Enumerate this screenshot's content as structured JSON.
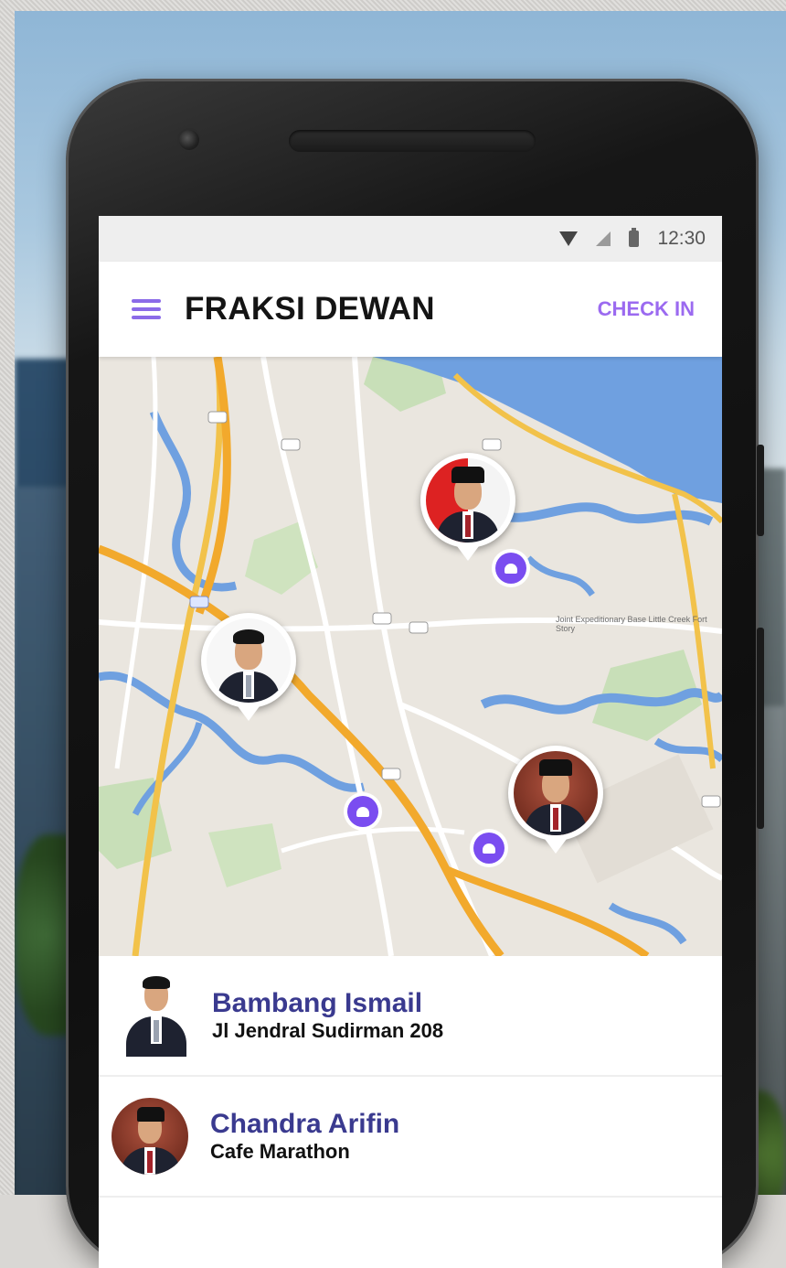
{
  "status_bar": {
    "time": "12:30"
  },
  "app_bar": {
    "title": "FRAKSI DEWAN",
    "action_label": "CHECK IN"
  },
  "map": {
    "labels": [
      "Joint Expeditionary Base Little Creek Fort Story"
    ]
  },
  "people": [
    {
      "name": "Bambang Ismail",
      "location": "Jl Jendral Sudirman 208"
    },
    {
      "name": "Chandra Arifin",
      "location": "Cafe Marathon"
    }
  ],
  "colors": {
    "accent": "#8b6be8",
    "name_text": "#3a3a8f",
    "poi_marker": "#7a4df0",
    "map_water": "#6fa0e0",
    "map_highway": "#f2a92c"
  },
  "icons": [
    "menu-icon",
    "wifi-icon",
    "signal-icon",
    "battery-icon",
    "camera-icon"
  ]
}
